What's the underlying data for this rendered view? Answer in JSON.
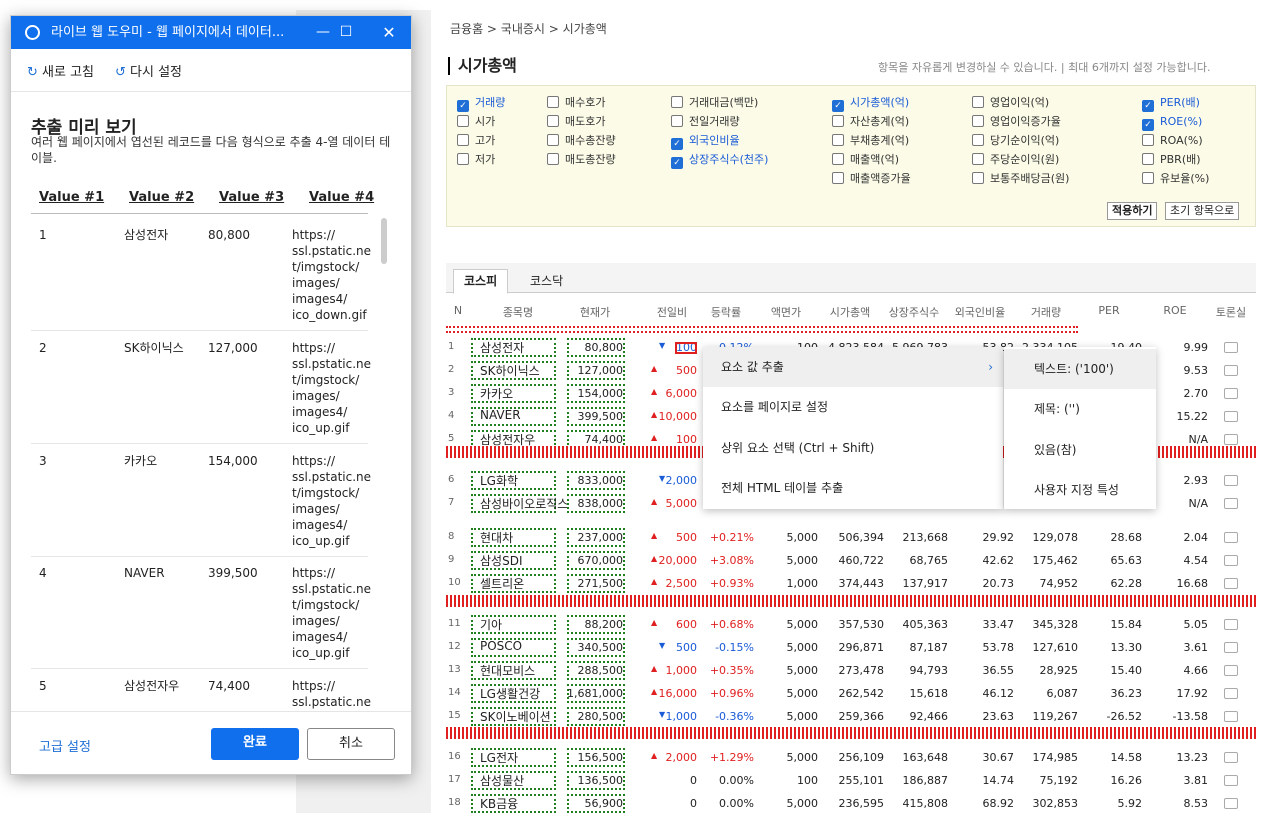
{
  "dialog": {
    "title": "라이브 웹 도우미 - 웹 페이지에서 데이터...",
    "refresh": "새로 고침",
    "reset": "다시 설정",
    "heading": "추출 미리 보기",
    "desc": "여러 웹 페이지에서 엽선된 레코드를 다음 형식으로 추출 4-열 데이터 테이블.",
    "columns": [
      "Value #1",
      "Value #2",
      "Value #3",
      "Value #4"
    ],
    "rows": [
      [
        "1",
        "삼성전자",
        "80,800",
        "https://\nssl.pstatic.ne\nt/imgstock/\nimages/\nimages4/\nico_down.gif"
      ],
      [
        "2",
        "SK하이닉스",
        "127,000",
        "https://\nssl.pstatic.ne\nt/imgstock/\nimages/\nimages4/\nico_up.gif"
      ],
      [
        "3",
        "카카오",
        "154,000",
        "https://\nssl.pstatic.ne\nt/imgstock/\nimages/\nimages4/\nico_up.gif"
      ],
      [
        "4",
        "NAVER",
        "399,500",
        "https://\nssl.pstatic.ne\nt/imgstock/\nimages/\nimages4/\nico_up.gif"
      ],
      [
        "5",
        "삼성전자우",
        "74,400",
        "https://\nssl.pstatic.ne"
      ]
    ],
    "advanced": "고급 설정",
    "done": "완료",
    "cancel": "취소"
  },
  "page": {
    "breadcrumb": "금융홈 > 국내증시 > 시가총액",
    "title": "시가총액",
    "note": "항목을 자유롭게 변경하실 수 있습니다.   |   최대 6개까지 설정 가능합니다.",
    "options": [
      [
        "거래량",
        true
      ],
      [
        "시가",
        false
      ],
      [
        "고가",
        false
      ],
      [
        "저가",
        false
      ],
      [
        "매수호가",
        false
      ],
      [
        "매도호가",
        false
      ],
      [
        "매수총잔량",
        false
      ],
      [
        "매도총잔량",
        false
      ],
      [
        "거래대금(백만)",
        false
      ],
      [
        "전일거래량",
        false
      ],
      [
        "외국인비율",
        true
      ],
      [
        "상장주식수(천주)",
        true
      ],
      [
        "시가총액(억)",
        true
      ],
      [
        "자산총계(억)",
        false
      ],
      [
        "부채총계(억)",
        false
      ],
      [
        "매출액(억)",
        false
      ],
      [
        "매출액증가율",
        false
      ],
      [
        "영업이익(억)",
        false
      ],
      [
        "영업이익증가율",
        false
      ],
      [
        "당기순이익(억)",
        false
      ],
      [
        "주당순이익(원)",
        false
      ],
      [
        "보통주배당금(원)",
        false
      ],
      [
        "PER(배)",
        true
      ],
      [
        "ROE(%)",
        true
      ],
      [
        "ROA(%)",
        false
      ],
      [
        "PBR(배)",
        false
      ],
      [
        "유보율(%)",
        false
      ]
    ],
    "apply": "적용하기",
    "init": "초기 항목으로",
    "tabs": [
      "코스피",
      "코스닥"
    ],
    "headers": [
      "N",
      "종목명",
      "현재가",
      "전일비",
      "등락률",
      "액면가",
      "시가총액",
      "상장주식수",
      "외국인비율",
      "거래량",
      "PER",
      "ROE",
      "토론실"
    ],
    "rows": [
      [
        "1",
        "삼성전자",
        "80,800",
        "down",
        "100",
        "-0.12%",
        "100",
        "4,823,584",
        "5,969,783",
        "53.82",
        "2,334,105",
        "19.40",
        "9.99"
      ],
      [
        "2",
        "SK하이닉스",
        "127,000",
        "up",
        "500",
        "",
        "",
        "",
        "",
        "",
        "",
        "",
        "9.53"
      ],
      [
        "3",
        "카카오",
        "154,000",
        "up",
        "6,000",
        "",
        "",
        "",
        "",
        "",
        "",
        "",
        "2.70"
      ],
      [
        "4",
        "NAVER",
        "399,500",
        "up",
        "10,000",
        "",
        "",
        "",
        "",
        "",
        "",
        "",
        "15.22"
      ],
      [
        "5",
        "삼성전자우",
        "74,400",
        "up",
        "100",
        "",
        "",
        "",
        "",
        "",
        "",
        "",
        "N/A"
      ],
      [
        "6",
        "LG화학",
        "833,000",
        "down",
        "2,000",
        "",
        "",
        "",
        "",
        "",
        "",
        "",
        "2.93"
      ],
      [
        "7",
        "삼성바이오로직스",
        "838,000",
        "up",
        "5,000",
        "",
        "",
        "",
        "",
        "",
        "",
        "",
        "N/A"
      ],
      [
        "8",
        "현대차",
        "237,000",
        "up",
        "500",
        "+0.21%",
        "5,000",
        "506,394",
        "213,668",
        "29.92",
        "129,078",
        "28.68",
        "2.04"
      ],
      [
        "9",
        "삼성SDI",
        "670,000",
        "up",
        "20,000",
        "+3.08%",
        "5,000",
        "460,722",
        "68,765",
        "42.62",
        "175,462",
        "65.63",
        "4.54"
      ],
      [
        "10",
        "셀트리온",
        "271,500",
        "up",
        "2,500",
        "+0.93%",
        "1,000",
        "374,443",
        "137,917",
        "20.73",
        "74,952",
        "62.28",
        "16.68"
      ],
      [
        "11",
        "기아",
        "88,200",
        "up",
        "600",
        "+0.68%",
        "5,000",
        "357,530",
        "405,363",
        "33.47",
        "345,328",
        "15.84",
        "5.05"
      ],
      [
        "12",
        "POSCO",
        "340,500",
        "down",
        "500",
        "-0.15%",
        "5,000",
        "296,871",
        "87,187",
        "53.78",
        "127,610",
        "13.30",
        "3.61"
      ],
      [
        "13",
        "현대모비스",
        "288,500",
        "up",
        "1,000",
        "+0.35%",
        "5,000",
        "273,478",
        "94,793",
        "36.55",
        "28,925",
        "15.40",
        "4.66"
      ],
      [
        "14",
        "LG생활건강",
        "1,681,000",
        "up",
        "16,000",
        "+0.96%",
        "5,000",
        "262,542",
        "15,618",
        "46.12",
        "6,087",
        "36.23",
        "17.92"
      ],
      [
        "15",
        "SK이노베이션",
        "280,500",
        "down",
        "1,000",
        "-0.36%",
        "5,000",
        "259,366",
        "92,466",
        "23.63",
        "119,267",
        "-26.52",
        "-13.58"
      ],
      [
        "16",
        "LG전자",
        "156,500",
        "up",
        "2,000",
        "+1.29%",
        "5,000",
        "256,109",
        "163,648",
        "30.67",
        "174,985",
        "14.58",
        "13.23"
      ],
      [
        "17",
        "삼성물산",
        "136,500",
        "",
        "0",
        "0.00%",
        "100",
        "255,101",
        "186,887",
        "14.74",
        "75,192",
        "16.26",
        "3.81"
      ],
      [
        "18",
        "KB금융",
        "56,900",
        "",
        "0",
        "0.00%",
        "5,000",
        "236,595",
        "415,808",
        "68.92",
        "302,853",
        "5.92",
        "8.53"
      ]
    ]
  },
  "menu": {
    "items": [
      "요소 값 추출",
      "요소를 페이지로 설정",
      "상위 요소 선택  (Ctrl + Shift)",
      "전체 HTML 테이블 추출"
    ],
    "sub": [
      "텍스트:  ('100')",
      "제목:  ('')",
      "있음(참)",
      "사용자 지정 특성"
    ]
  }
}
